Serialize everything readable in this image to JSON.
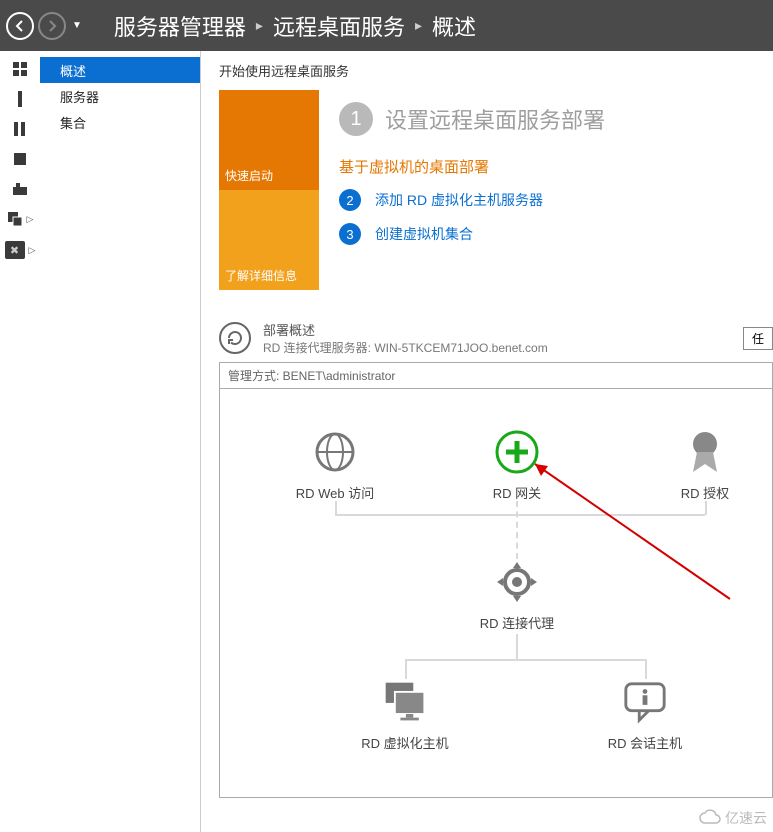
{
  "header": {
    "breadcrumb": [
      "服务器管理器",
      "远程桌面服务",
      "概述"
    ]
  },
  "sidebar": {
    "items": [
      {
        "label": "概述",
        "selected": true
      },
      {
        "label": "服务器",
        "selected": false
      },
      {
        "label": "集合",
        "selected": false
      }
    ]
  },
  "quickstart": {
    "section_title": "开始使用远程桌面服务",
    "tile_top": "快速启动",
    "tile_bottom": "了解详细信息",
    "step1": {
      "num": "1",
      "title": "设置远程桌面服务部署"
    },
    "subtitle": "基于虚拟机的桌面部署",
    "steps": [
      {
        "num": "2",
        "label": "添加 RD 虚拟化主机服务器"
      },
      {
        "num": "3",
        "label": "创建虚拟机集合"
      }
    ]
  },
  "deployment": {
    "title": "部署概述",
    "subtitle": "RD 连接代理服务器: WIN-5TKCEM71JOO.benet.com",
    "task_button": "任",
    "managed_by": "管理方式: BENET\\administrator",
    "nodes": {
      "rd_web": "RD Web 访问",
      "rd_gateway": "RD 网关",
      "rd_license": "RD 授权",
      "rd_broker": "RD 连接代理",
      "rd_virt": "RD 虚拟化主机",
      "rd_session": "RD 会话主机"
    }
  },
  "watermark": "亿速云"
}
